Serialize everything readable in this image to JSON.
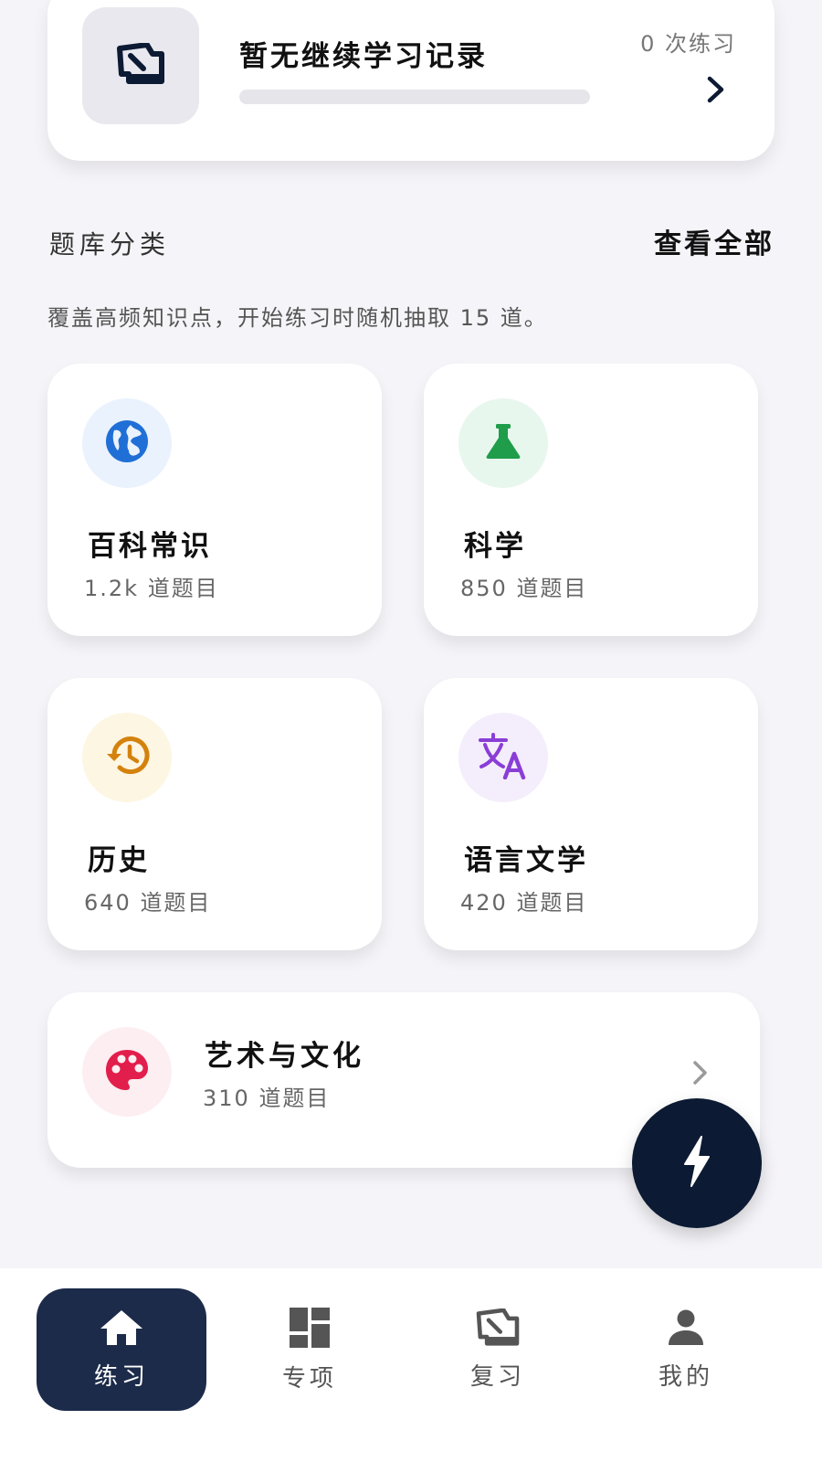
{
  "continue_card": {
    "title": "暂无继续学习记录",
    "count": "0 次练习",
    "progress": 0,
    "icon": "review-book-icon"
  },
  "section": {
    "title": "题库分类",
    "view_all": "查看全部",
    "description": "覆盖高频知识点，开始练习时随机抽取 15 道。"
  },
  "categories": [
    {
      "name": "百科常识",
      "count": "1.2k 道题目",
      "icon": "globe-icon",
      "color": "#1f6fd6",
      "bg": "#eaf2fd"
    },
    {
      "name": "科学",
      "count": "850 道题目",
      "icon": "flask-icon",
      "color": "#1f9d4a",
      "bg": "#e8f7ee"
    },
    {
      "name": "历史",
      "count": "640 道题目",
      "icon": "history-icon",
      "color": "#d4820e",
      "bg": "#fdf6e3"
    },
    {
      "name": "语言文学",
      "count": "420 道题目",
      "icon": "translate-icon",
      "color": "#8a3ed6",
      "bg": "#f4eefc"
    },
    {
      "name": "艺术与文化",
      "count": "310 道题目",
      "icon": "palette-icon",
      "color": "#e21e4c",
      "bg": "#fdeef1"
    }
  ],
  "fab": {
    "icon": "lightning-icon",
    "color": "#0c1a33"
  },
  "nav": [
    {
      "label": "练习",
      "icon": "home-icon",
      "active": true
    },
    {
      "label": "专项",
      "icon": "dashboard-icon",
      "active": false
    },
    {
      "label": "复习",
      "icon": "review-book-icon",
      "active": false
    },
    {
      "label": "我的",
      "icon": "person-icon",
      "active": false
    }
  ]
}
